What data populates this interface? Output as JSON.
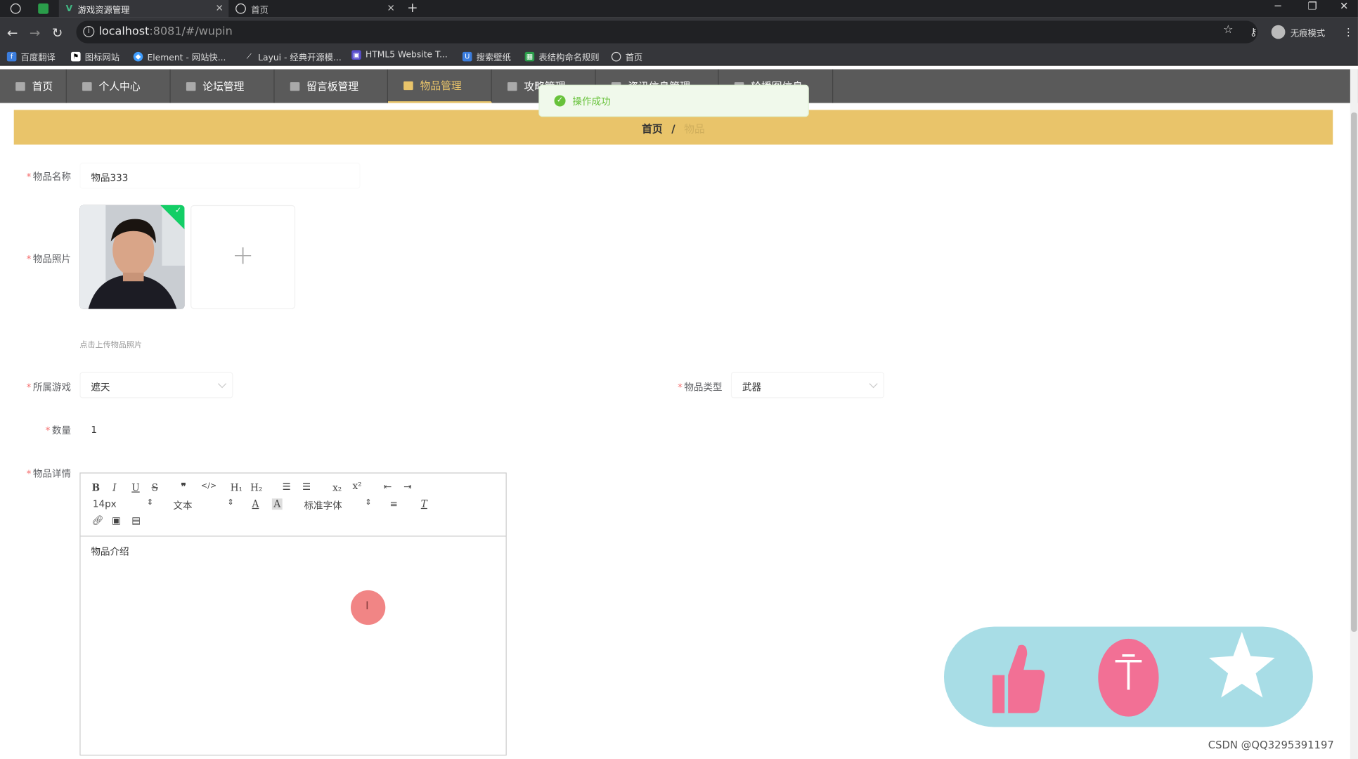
{
  "browser": {
    "tabs": [
      {
        "title": "游戏资源管理"
      },
      {
        "title": "首页"
      }
    ],
    "url_host": "localhost",
    "url_rest": ":8081/#/wupin",
    "profile_label": "无痕模式",
    "bookmarks": [
      "百度翻译",
      "图标网站",
      "Element - 网站快...",
      "Layui - 经典开源模...",
      "HTML5 Website T...",
      "搜索壁纸",
      "表结构命名规则",
      "首页"
    ]
  },
  "nav": {
    "items": [
      "首页",
      "个人中心",
      "论坛管理",
      "留言板管理",
      "物品管理",
      "攻略管理",
      "资讯信息管理",
      "轮播图信息"
    ]
  },
  "toast": {
    "message": "操作成功"
  },
  "breadcrumb": {
    "home": "首页",
    "sep": "/",
    "current": "物品"
  },
  "form": {
    "name_label": "物品名称",
    "name_value": "物品333",
    "photo_label": "物品照片",
    "photo_tip": "点击上传物品照片",
    "game_label": "所属游戏",
    "game_value": "遮天",
    "type_label": "物品类型",
    "type_value": "武器",
    "qty_label": "数量",
    "qty_value": "1",
    "detail_label": "物品详情"
  },
  "editor": {
    "size_value": "14px",
    "header_value": "文本",
    "font_value": "标准字体",
    "content": "物品介绍"
  },
  "colors": {
    "accent": "#e9c46a",
    "nav_bg": "#5a5a5a",
    "success": "#67c23a",
    "fab_bg": "#a8dde6",
    "fab_pink": "#f27095"
  },
  "watermark": "CSDN @QQ3295391197"
}
